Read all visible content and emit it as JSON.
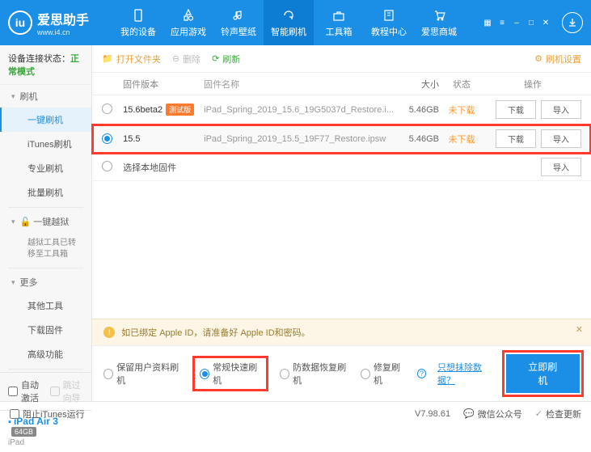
{
  "titlebar": {
    "app_name": "爱思助手",
    "url": "www.i4.cn",
    "logo_letter": "iu"
  },
  "nav": [
    {
      "label": "我的设备",
      "icon": "phone"
    },
    {
      "label": "应用游戏",
      "icon": "app"
    },
    {
      "label": "铃声壁纸",
      "icon": "music"
    },
    {
      "label": "智能刷机",
      "icon": "refresh",
      "active": true
    },
    {
      "label": "工具箱",
      "icon": "toolbox"
    },
    {
      "label": "教程中心",
      "icon": "book"
    },
    {
      "label": "爱思商城",
      "icon": "cart"
    }
  ],
  "sidebar": {
    "status_label": "设备连接状态：",
    "status_value": "正常模式",
    "sections": [
      {
        "title": "刷机",
        "items": [
          {
            "label": "一键刷机",
            "active": true
          },
          {
            "label": "iTunes刷机"
          },
          {
            "label": "专业刷机"
          },
          {
            "label": "批量刷机"
          }
        ]
      },
      {
        "title": "一键越狱",
        "info": "越狱工具已转移至工具箱"
      },
      {
        "title": "更多",
        "items": [
          {
            "label": "其他工具"
          },
          {
            "label": "下载固件"
          },
          {
            "label": "高级功能"
          }
        ]
      }
    ],
    "auto_activate": "自动激活",
    "skip_guide": "跳过向导",
    "device_name": "iPad Air 3",
    "device_storage": "64GB",
    "device_type": "iPad"
  },
  "toolbar": {
    "open": "打开文件夹",
    "delete": "删除",
    "refresh": "刷新",
    "settings": "刷机设置"
  },
  "table": {
    "headers": {
      "version": "固件版本",
      "name": "固件名称",
      "size": "大小",
      "status": "状态",
      "ops": "操作"
    },
    "rows": [
      {
        "version": "15.6beta2",
        "badge": "测试版",
        "name": "iPad_Spring_2019_15.6_19G5037d_Restore.i...",
        "size": "5.46GB",
        "status": "未下载",
        "selected": false,
        "highlight": false
      },
      {
        "version": "15.5",
        "name": "iPad_Spring_2019_15.5_19F77_Restore.ipsw",
        "size": "5.46GB",
        "status": "未下载",
        "selected": true,
        "highlight": true
      }
    ],
    "local_label": "选择本地固件",
    "btn_download": "下载",
    "btn_import": "导入"
  },
  "notice": "如已绑定 Apple ID，请准备好 Apple ID和密码。",
  "options": {
    "keep_data": "保留用户资料刷机",
    "normal": "常规快速刷机",
    "anti_recovery": "防数据恢复刷机",
    "repair": "修复刷机",
    "exclude_link": "只想抹除数据？",
    "flash_btn": "立即刷机"
  },
  "footer": {
    "block_itunes": "阻止iTunes运行",
    "version": "V7.98.61",
    "wechat": "微信公众号",
    "check_update": "检查更新"
  }
}
